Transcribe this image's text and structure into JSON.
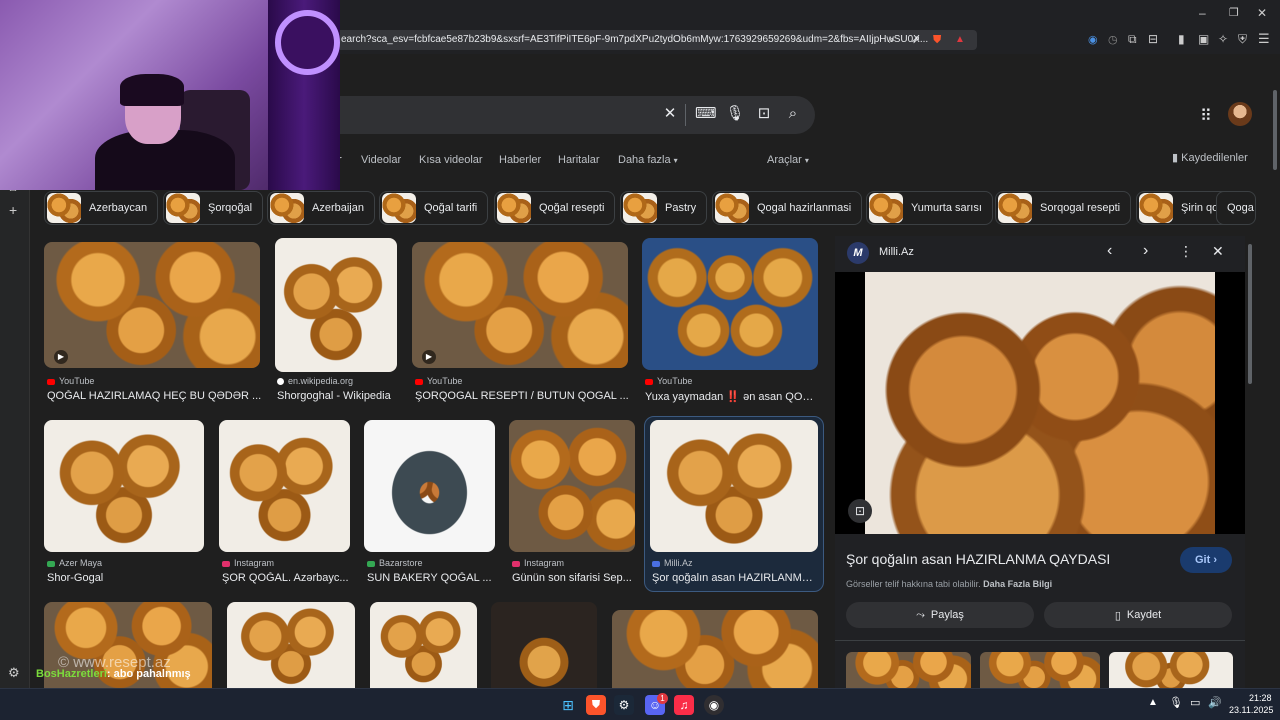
{
  "browser": {
    "url": "earch?sca_esv=fcbfcae5e87b23b9&sxsrf=AE3TifPiITE6pF-9m7pdXPu2tydOb6mMyw:1763929659269&udm=2&fbs=AIIjpHwSU0X...",
    "window_controls": [
      "–",
      "❐",
      "✕"
    ]
  },
  "tabs": {
    "active_partial": "r",
    "items": [
      "Videolar",
      "Kısa videolar",
      "Haberler",
      "Haritalar",
      "Daha fazla"
    ],
    "tools": "Araçlar",
    "saved": "Kaydedilenler"
  },
  "chips": [
    "Azerbaycan",
    "Şorqoğal",
    "Azerbaijan",
    "Qoğal tarifi",
    "Qoğal resepti",
    "Pastry",
    "Qogal hazirlanmasi",
    "Yumurta sarısı",
    "Sorqogal resepti",
    "Şirin qogal",
    "Qoga"
  ],
  "results_row1": [
    {
      "source": "YouTube",
      "title": "QOĞAL HAZIRLAMAQ HEÇ BU QƏDƏR ...",
      "source_color": "#ff0000"
    },
    {
      "source": "en.wikipedia.org",
      "title": "Shorgoghal - Wikipedia",
      "source_color": "#ffffff"
    },
    {
      "source": "YouTube",
      "title": "ŞORQOGAL RESEPTI / BUTUN QOGAL ...",
      "source_color": "#ff0000"
    },
    {
      "source": "YouTube",
      "title": "Yuxa yaymadan ‼️ ən asan QOĞ...",
      "source_color": "#ff0000"
    }
  ],
  "results_row2": [
    {
      "source": "Azer Maya",
      "title": "Shor-Gogal",
      "source_color": "#34a853"
    },
    {
      "source": "Instagram",
      "title": "ŞOR QOĞAL. Azərbayc...",
      "source_color": "#e1306c"
    },
    {
      "source": "Bazarstore",
      "title": "SUN BAKERY QOĞAL ...",
      "source_color": "#34a853"
    },
    {
      "source": "Instagram",
      "title": "Günün son sifarisi Sep...",
      "source_color": "#e1306c"
    },
    {
      "source": "Milli.Az",
      "title": "Şor qoğalın asan HAZIRLANMA...",
      "source_color": "#4a6ee0"
    }
  ],
  "panel": {
    "site": "Milli.Az",
    "site_logo": "M",
    "title": "Şor qoğalın asan HAZIRLANMA QAYDASI",
    "go_button": "Git",
    "copyright_note": "Görseller telif hakkına tabi olabilir.",
    "more_info": "Daha Fazla Bilgi",
    "share": "Paylaş",
    "save": "Kaydet"
  },
  "watermark": "© www.resept.az",
  "chat": {
    "user": "BosHazretleri",
    "message": ": abo pahalnmış"
  },
  "taskbar": {
    "time": "21:28",
    "date": "23.11.2025",
    "discord_badge": "1"
  }
}
